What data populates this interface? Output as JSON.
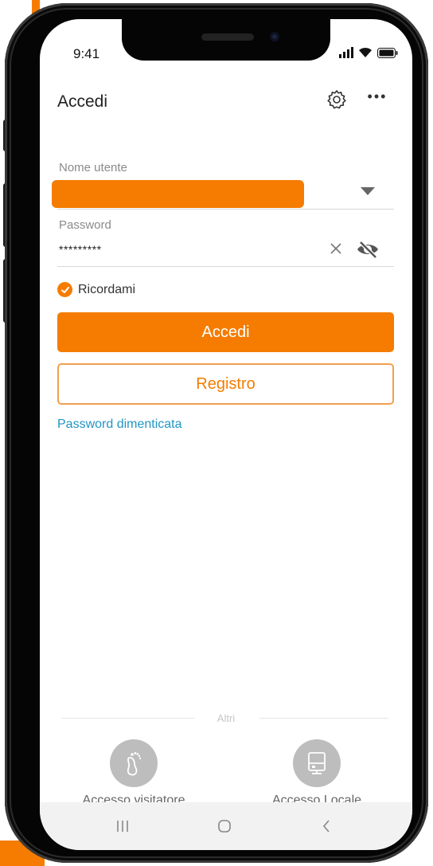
{
  "status_bar": {
    "time": "9:41"
  },
  "header": {
    "title": "Accedi",
    "settings_icon": "gear-icon",
    "more_icon": "more-icon",
    "more_label": "•••"
  },
  "form": {
    "username_label": "Nome utente",
    "password_label": "Password",
    "password_value": "*********",
    "remember_label": "Ricordami",
    "remember_checked": true
  },
  "buttons": {
    "login_label": "Accedi",
    "register_label": "Registro"
  },
  "links": {
    "forgot_password": "Password dimenticata"
  },
  "other": {
    "divider_label": "Altri",
    "options": [
      {
        "label": "Accesso visitatore",
        "icon": "footprint-icon"
      },
      {
        "label": "Accesso Locale",
        "icon": "local-device-icon"
      }
    ]
  },
  "colors": {
    "accent": "#f57c00",
    "link": "#2196c4",
    "register_border": "#f0a050"
  }
}
